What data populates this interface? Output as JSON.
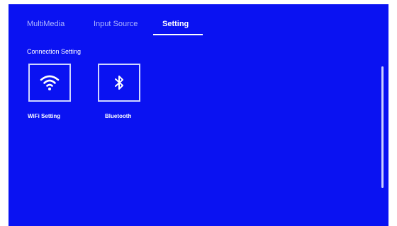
{
  "tabs": [
    {
      "label": "MultiMedia",
      "active": false
    },
    {
      "label": "Input Source",
      "active": false
    },
    {
      "label": "Setting",
      "active": true
    }
  ],
  "section": {
    "title": "Connection Setting"
  },
  "tiles": [
    {
      "label": "WiFi Setting",
      "icon": "wifi-icon"
    },
    {
      "label": "Bluetooth",
      "icon": "bluetooth-icon"
    }
  ],
  "colors": {
    "background": "#0a12f2",
    "text": "#ffffff",
    "inactive_tab": "#aeb6ff",
    "tile_border": "#d0d6ff"
  }
}
